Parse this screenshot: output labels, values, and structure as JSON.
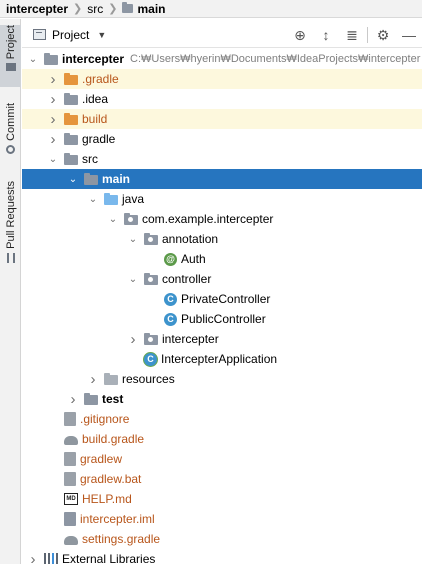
{
  "breadcrumb": {
    "root": "intercepter",
    "mid": "src",
    "leaf": "main"
  },
  "side_tabs": [
    {
      "label": "Project"
    },
    {
      "label": "Commit"
    },
    {
      "label": "Pull Requests"
    }
  ],
  "toolbar": {
    "title": "Project"
  },
  "project_path": "C:₩Users₩hyerin₩Documents₩IdeaProjects₩intercepter",
  "tree": [
    {
      "label": "intercepter",
      "depth": 0,
      "arrow": "open",
      "icon": "module-folder",
      "bold": true,
      "path": true
    },
    {
      "label": ".gradle",
      "depth": 1,
      "arrow": "closed",
      "icon": "folder-orange",
      "color": "orange",
      "highlight": true
    },
    {
      "label": ".idea",
      "depth": 1,
      "arrow": "closed",
      "icon": "folder-gray"
    },
    {
      "label": "build",
      "depth": 1,
      "arrow": "closed",
      "icon": "folder-orange",
      "color": "orange",
      "highlight": true
    },
    {
      "label": "gradle",
      "depth": 1,
      "arrow": "closed",
      "icon": "folder-gray"
    },
    {
      "label": "src",
      "depth": 1,
      "arrow": "open",
      "icon": "folder-gray"
    },
    {
      "label": "main",
      "depth": 2,
      "arrow": "open",
      "icon": "folder-gray",
      "bold": true,
      "selected": true
    },
    {
      "label": "java",
      "depth": 3,
      "arrow": "open",
      "icon": "folder-blue"
    },
    {
      "label": "com.example.intercepter",
      "depth": 4,
      "arrow": "open",
      "icon": "package"
    },
    {
      "label": "annotation",
      "depth": 5,
      "arrow": "open",
      "icon": "package"
    },
    {
      "label": "Auth",
      "depth": 6,
      "arrow": "none",
      "icon": "annotation"
    },
    {
      "label": "controller",
      "depth": 5,
      "arrow": "open",
      "icon": "package"
    },
    {
      "label": "PrivateController",
      "depth": 6,
      "arrow": "none",
      "icon": "class"
    },
    {
      "label": "PublicController",
      "depth": 6,
      "arrow": "none",
      "icon": "class"
    },
    {
      "label": "intercepter",
      "depth": 5,
      "arrow": "closed",
      "icon": "package"
    },
    {
      "label": "IntercepterApplication",
      "depth": 5,
      "arrow": "none",
      "icon": "spring-class"
    },
    {
      "label": "resources",
      "depth": 3,
      "arrow": "closed",
      "icon": "resources"
    },
    {
      "label": "test",
      "depth": 2,
      "arrow": "closed",
      "icon": "folder-gray",
      "bold": true
    },
    {
      "label": ".gitignore",
      "depth": 1,
      "arrow": "none",
      "icon": "gitignore",
      "color": "orange"
    },
    {
      "label": "build.gradle",
      "depth": 1,
      "arrow": "none",
      "icon": "gradle",
      "color": "orange"
    },
    {
      "label": "gradlew",
      "depth": 1,
      "arrow": "none",
      "icon": "file",
      "color": "orange"
    },
    {
      "label": "gradlew.bat",
      "depth": 1,
      "arrow": "none",
      "icon": "file",
      "color": "orange"
    },
    {
      "label": "HELP.md",
      "depth": 1,
      "arrow": "none",
      "icon": "md",
      "color": "orange"
    },
    {
      "label": "intercepter.iml",
      "depth": 1,
      "arrow": "none",
      "icon": "iml",
      "color": "orange"
    },
    {
      "label": "settings.gradle",
      "depth": 1,
      "arrow": "none",
      "icon": "gradle",
      "color": "orange"
    },
    {
      "label": "External Libraries",
      "depth": 0,
      "arrow": "closed",
      "icon": "libraries"
    }
  ],
  "colors": {
    "selection": "#2675bf",
    "highlight": "#fdf8dd",
    "orange_text": "#b8561b",
    "folder_gray": "#8d96a3",
    "folder_orange": "#e5953d",
    "folder_blue": "#79b8ec",
    "class_icon": "#3d93cc",
    "annotation_icon": "#5c9a4a"
  }
}
